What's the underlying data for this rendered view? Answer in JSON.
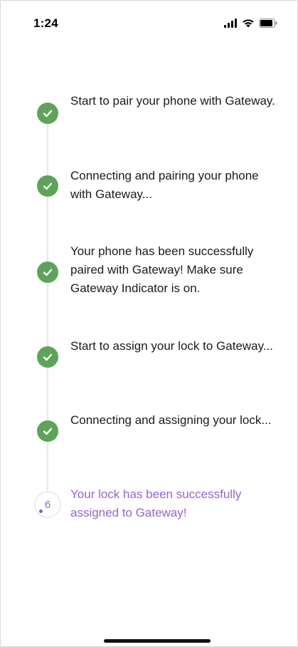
{
  "status_bar": {
    "time": "1:24",
    "icons": [
      "signal-icon",
      "wifi-icon",
      "battery-icon"
    ]
  },
  "steps": [
    {
      "state": "done",
      "icon": "check-icon",
      "text": "Start to pair your phone with Gateway."
    },
    {
      "state": "done",
      "icon": "check-icon",
      "text": "Connecting and pairing your phone with Gateway..."
    },
    {
      "state": "done",
      "icon": "check-icon",
      "text": "Your phone has been successfully paired with Gateway! Make sure Gateway Indicator is on."
    },
    {
      "state": "done",
      "icon": "check-icon",
      "text": "Start to assign your lock to Gateway..."
    },
    {
      "state": "done",
      "icon": "check-icon",
      "text": "Connecting and assigning your lock..."
    },
    {
      "state": "in-progress",
      "number": "6",
      "text": "Your lock has been successfully assigned to Gateway!"
    }
  ],
  "colors": {
    "done": "#5ea35a",
    "pending_text": "#9466c9",
    "rail": "#e7e7e7"
  }
}
